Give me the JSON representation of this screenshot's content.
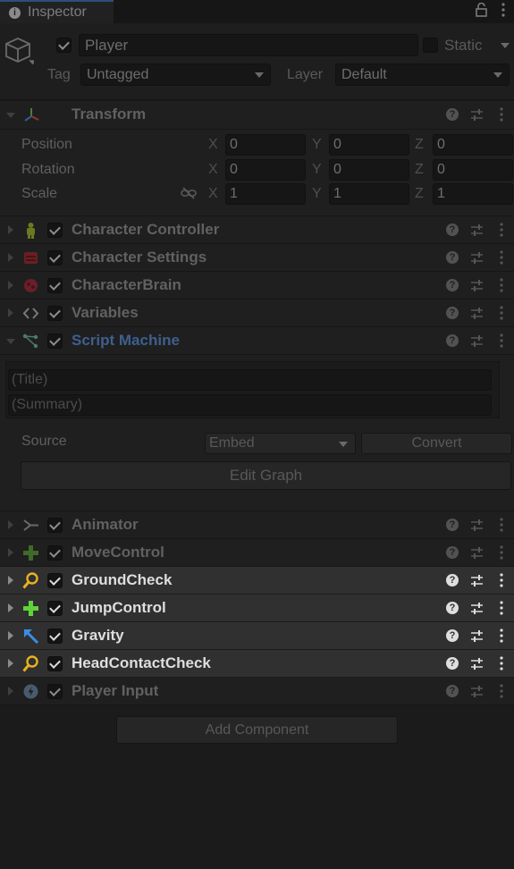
{
  "tab": {
    "title": "Inspector"
  },
  "header": {
    "object_name": "Player",
    "static_label": "Static",
    "tag_label": "Tag",
    "tag_value": "Untagged",
    "layer_label": "Layer",
    "layer_value": "Default"
  },
  "transform": {
    "title": "Transform",
    "rows": [
      {
        "label": "Position",
        "x": "0",
        "y": "0",
        "z": "0"
      },
      {
        "label": "Rotation",
        "x": "0",
        "y": "0",
        "z": "0"
      },
      {
        "label": "Scale",
        "x": "1",
        "y": "1",
        "z": "1"
      }
    ],
    "axis_x": "X",
    "axis_y": "Y",
    "axis_z": "Z"
  },
  "components": [
    {
      "name": "Character Controller",
      "icon": "character-controller-icon"
    },
    {
      "name": "Character Settings",
      "icon": "character-settings-icon"
    },
    {
      "name": "CharacterBrain",
      "icon": "character-brain-icon"
    },
    {
      "name": "Variables",
      "icon": "code-brackets-icon"
    },
    {
      "name": "Script Machine",
      "icon": "script-machine-icon"
    },
    {
      "name": "Animator",
      "icon": "animator-icon"
    },
    {
      "name": "MoveControl",
      "icon": "move-plus-icon"
    },
    {
      "name": "GroundCheck",
      "icon": "magnifier-icon"
    },
    {
      "name": "JumpControl",
      "icon": "move-plus-icon"
    },
    {
      "name": "Gravity",
      "icon": "arrow-up-left-icon"
    },
    {
      "name": "HeadContactCheck",
      "icon": "magnifier-icon"
    },
    {
      "name": "Player Input",
      "icon": "player-input-icon"
    }
  ],
  "script_machine": {
    "title_placeholder": "(Title)",
    "summary_placeholder": "(Summary)",
    "source_label": "Source",
    "source_value": "Embed",
    "convert_label": "Convert",
    "edit_graph_label": "Edit Graph"
  },
  "help_glyph": "?",
  "add_component_label": "Add Component",
  "colors": {
    "script_machine_title": "#3f5f8f",
    "accent_yellow": "#e7b21f",
    "accent_green": "#5fd43a",
    "accent_blue": "#3b8ee6"
  }
}
